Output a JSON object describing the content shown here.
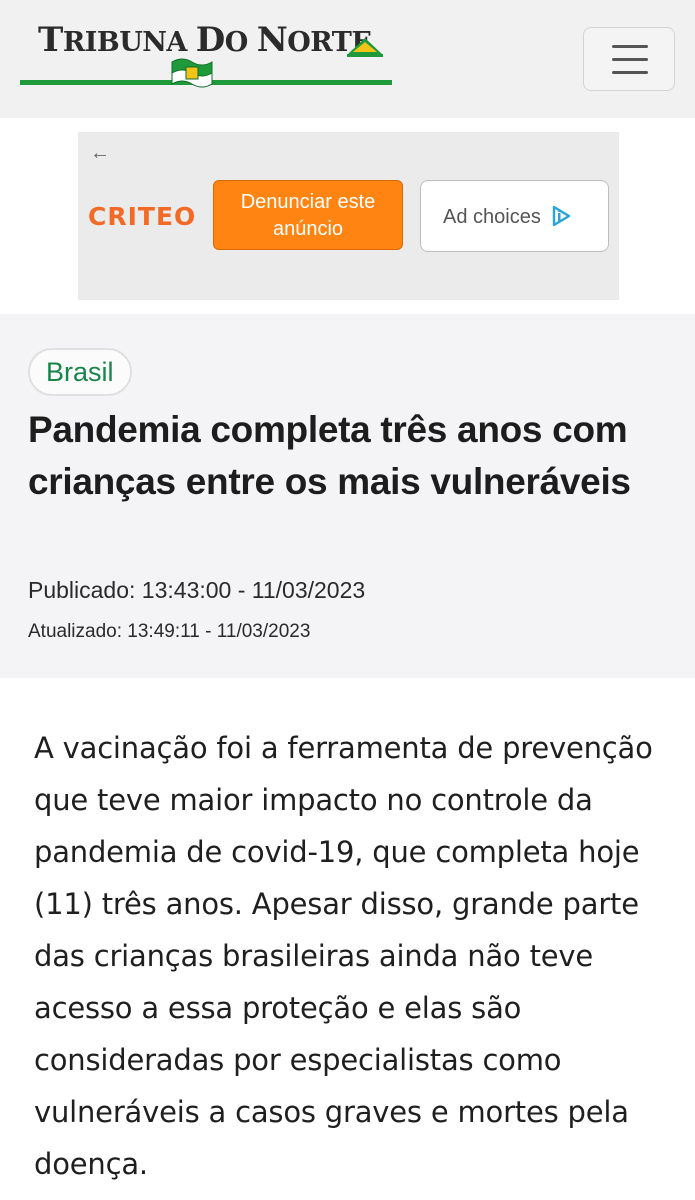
{
  "header": {
    "logo_text": "Tribuna do Norte",
    "logo_text_parts": [
      "T",
      "RIBUNA ",
      "D",
      "O ",
      "N",
      "ORTE"
    ],
    "menu_icon": "hamburger-menu-icon",
    "brand_green": "#1f9a3a"
  },
  "ad": {
    "back_icon": "arrow-left-icon",
    "criteo_logo": "CRITEO",
    "report_label": "Denunciar este anúncio",
    "choices_label": "Ad choices",
    "choices_icon": "adchoices-icon",
    "report_color": "#ff8411",
    "criteo_color": "#f26a26"
  },
  "article": {
    "category": "Brasil",
    "title": "Pandemia completa três anos com crianças entre os mais vulneráveis",
    "published": "Publicado: 13:43:00 - 11/03/2023",
    "updated": "Atualizado: 13:49:11 - 11/03/2023",
    "category_color": "#18854a",
    "body": "A vacinação foi a ferramenta de prevenção que teve maior impacto no controle da pandemia de covid-19, que completa hoje (11) três anos. Apesar disso, grande parte das crianças brasileiras ainda não teve acesso a essa proteção e elas são consideradas por especialistas como vulneráveis a casos graves e mortes pela doença."
  }
}
